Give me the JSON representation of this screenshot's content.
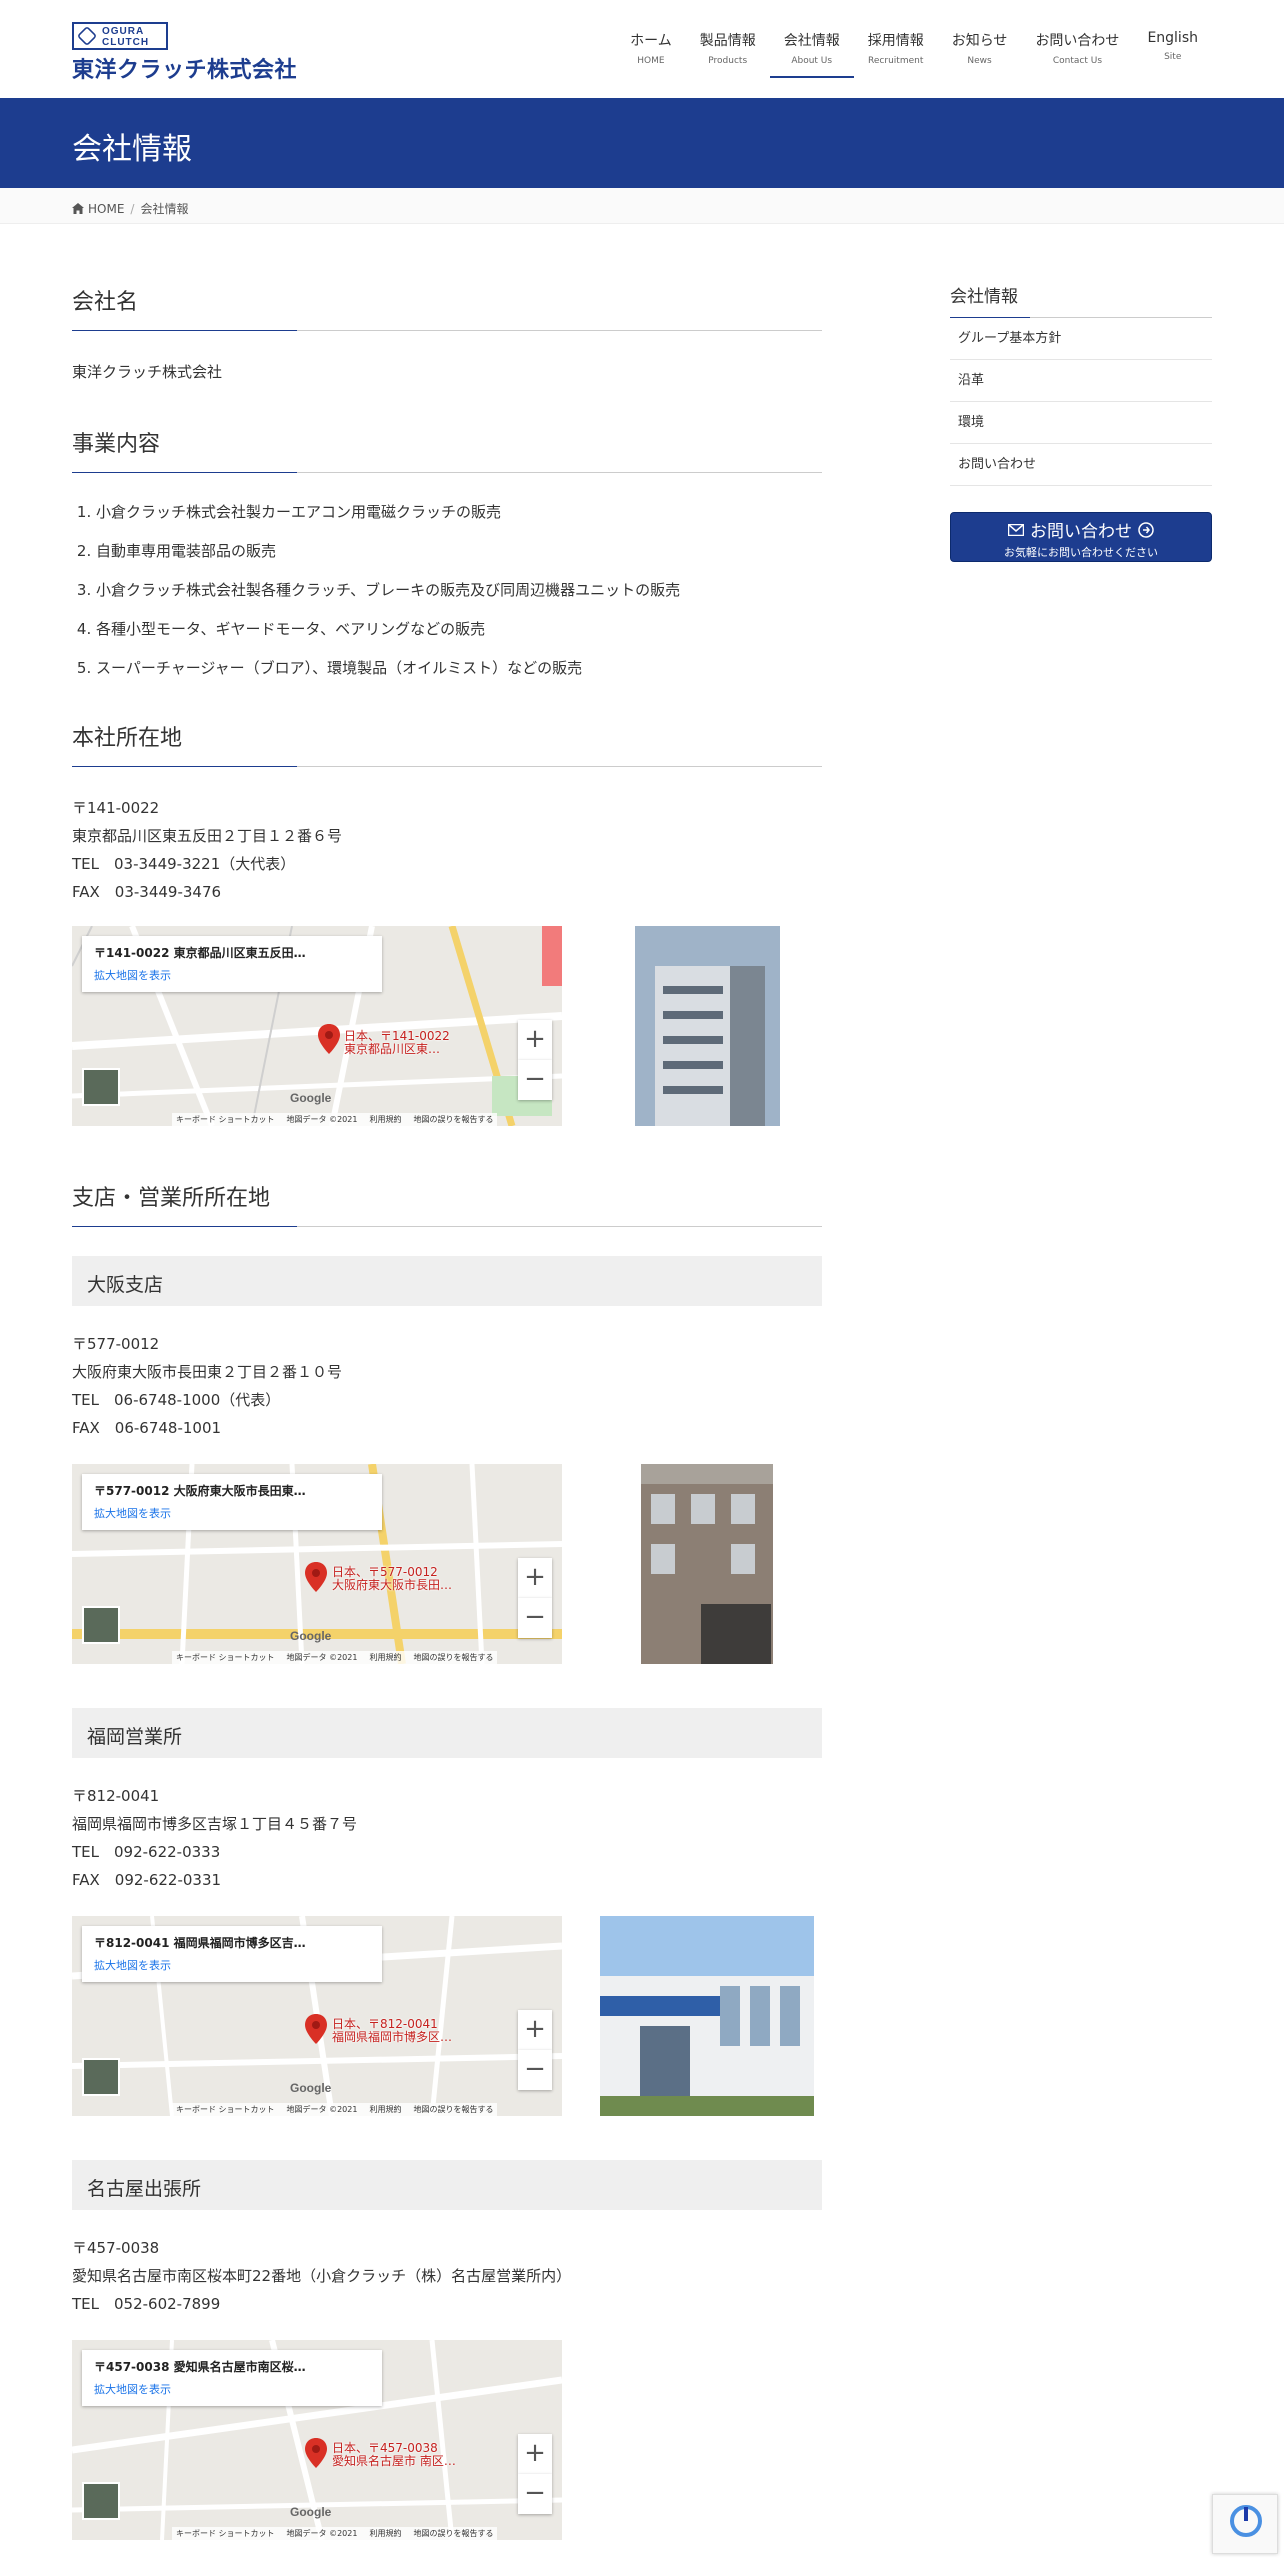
{
  "header": {
    "logo_en": "OGURA CLUTCH",
    "logo_jp": "東洋クラッチ株式会社",
    "nav": [
      {
        "jp": "ホーム",
        "en": "HOME"
      },
      {
        "jp": "製品情報",
        "en": "Products"
      },
      {
        "jp": "会社情報",
        "en": "About Us"
      },
      {
        "jp": "採用情報",
        "en": "Recruitment"
      },
      {
        "jp": "お知らせ",
        "en": "News"
      },
      {
        "jp": "お問い合わせ",
        "en": "Contact Us"
      },
      {
        "jp": "English",
        "en": "Site"
      }
    ],
    "active_index": 2
  },
  "page_title": "会社情報",
  "breadcrumb": {
    "home": "HOME",
    "current": "会社情報"
  },
  "company_name": {
    "heading": "会社名",
    "value": "東洋クラッチ株式会社"
  },
  "business": {
    "heading": "事業内容",
    "items": [
      "小倉クラッチ株式会社製カーエアコン用電磁クラッチの販売",
      "自動車専用電装部品の販売",
      "小倉クラッチ株式会社製各種クラッチ、ブレーキの販売及び同周辺機器ユニットの販売",
      "各種小型モータ、ギヤードモータ、ベアリングなどの販売",
      "スーパーチャージャー（ブロア）、環境製品（オイルミスト）などの販売"
    ]
  },
  "hq": {
    "heading": "本社所在地",
    "lines": [
      "〒141-0022",
      "東京都品川区東五反田２丁目１２番６号",
      "TEL　03-3449-3221（大代表）",
      "FAX　03-3449-3476"
    ],
    "map": {
      "card_addr": "〒141-0022 東京都品川区東五反田…",
      "pin_label_1": "日本、〒141-0022",
      "pin_label_2": "東京都品川区東…"
    }
  },
  "branches_heading": "支店・営業所所在地",
  "branches": [
    {
      "name": "大阪支店",
      "lines": [
        "〒577-0012",
        "大阪府東大阪市長田東２丁目２番１０号",
        "TEL　06-6748-1000（代表）",
        "FAX　06-6748-1001"
      ],
      "map": {
        "card_addr": "〒577-0012 大阪府東大阪市長田東…",
        "pin_label_1": "日本、〒577-0012",
        "pin_label_2": "大阪府東大阪市長田…"
      }
    },
    {
      "name": "福岡営業所",
      "lines": [
        "〒812-0041",
        "福岡県福岡市博多区吉塚１丁目４５番７号",
        "TEL　092-622-0333",
        "FAX　092-622-0331"
      ],
      "map": {
        "card_addr": "〒812-0041 福岡県福岡市博多区吉…",
        "pin_label_1": "日本、〒812-0041",
        "pin_label_2": "福岡県福岡市博多区…"
      }
    },
    {
      "name": "名古屋出張所",
      "lines": [
        "〒457-0038",
        "愛知県名古屋市南区桜本町22番地（小倉クラッチ（株）名古屋営業所内）",
        "TEL　052-602-7899"
      ],
      "map": {
        "card_addr": "〒457-0038 愛知県名古屋市南区桜…",
        "pin_label_1": "日本、〒457-0038",
        "pin_label_2": "愛知県名古屋市 南区…"
      }
    }
  ],
  "map_common": {
    "link": "拡大地図を表示",
    "google": "Google",
    "footer": [
      "キーボード ショートカット",
      "地図データ ©2021",
      "利用規約",
      "地図の誤りを報告する"
    ]
  },
  "sidebar": {
    "heading": "会社情報",
    "items": [
      "グループ基本方針",
      "沿革",
      "環境",
      "お問い合わせ"
    ],
    "contact_main": "お問い合わせ",
    "contact_sub": "お気軽にお問い合わせください"
  },
  "colors": {
    "brand": "#1d3d8f",
    "map_bg": "#e8e6e1",
    "pin": "#d93025"
  }
}
